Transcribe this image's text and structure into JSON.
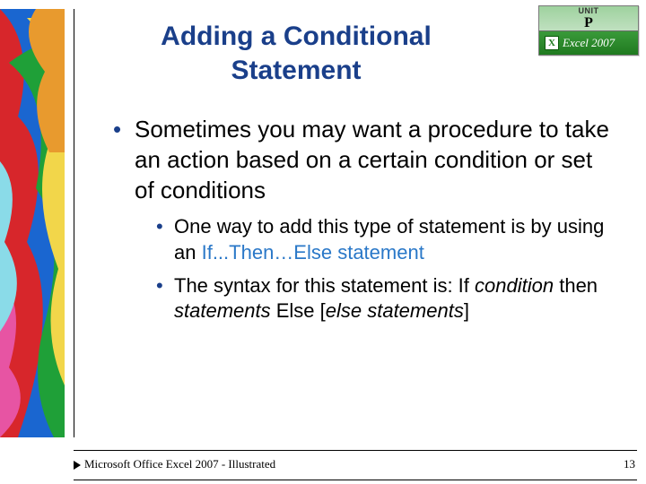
{
  "title": "Adding a Conditional Statement",
  "badge": {
    "unit_label": "UNIT",
    "unit_letter": "P",
    "product": "Excel 2007"
  },
  "bullets": {
    "l1": "Sometimes you may want a procedure to take an action based on a certain condition or set of conditions",
    "l2a_plain": "One way to add this type of statement is by using an ",
    "l2a_hl": "If...Then…Else statement",
    "l2b_pre": "The syntax for this statement is: If ",
    "l2b_it1": "condition",
    "l2b_mid1": " then ",
    "l2b_it2": "statements",
    "l2b_mid2": " Else [",
    "l2b_it3": "else statements",
    "l2b_post": "]"
  },
  "footer": {
    "text": "Microsoft Office Excel 2007 - Illustrated",
    "page": "13"
  }
}
